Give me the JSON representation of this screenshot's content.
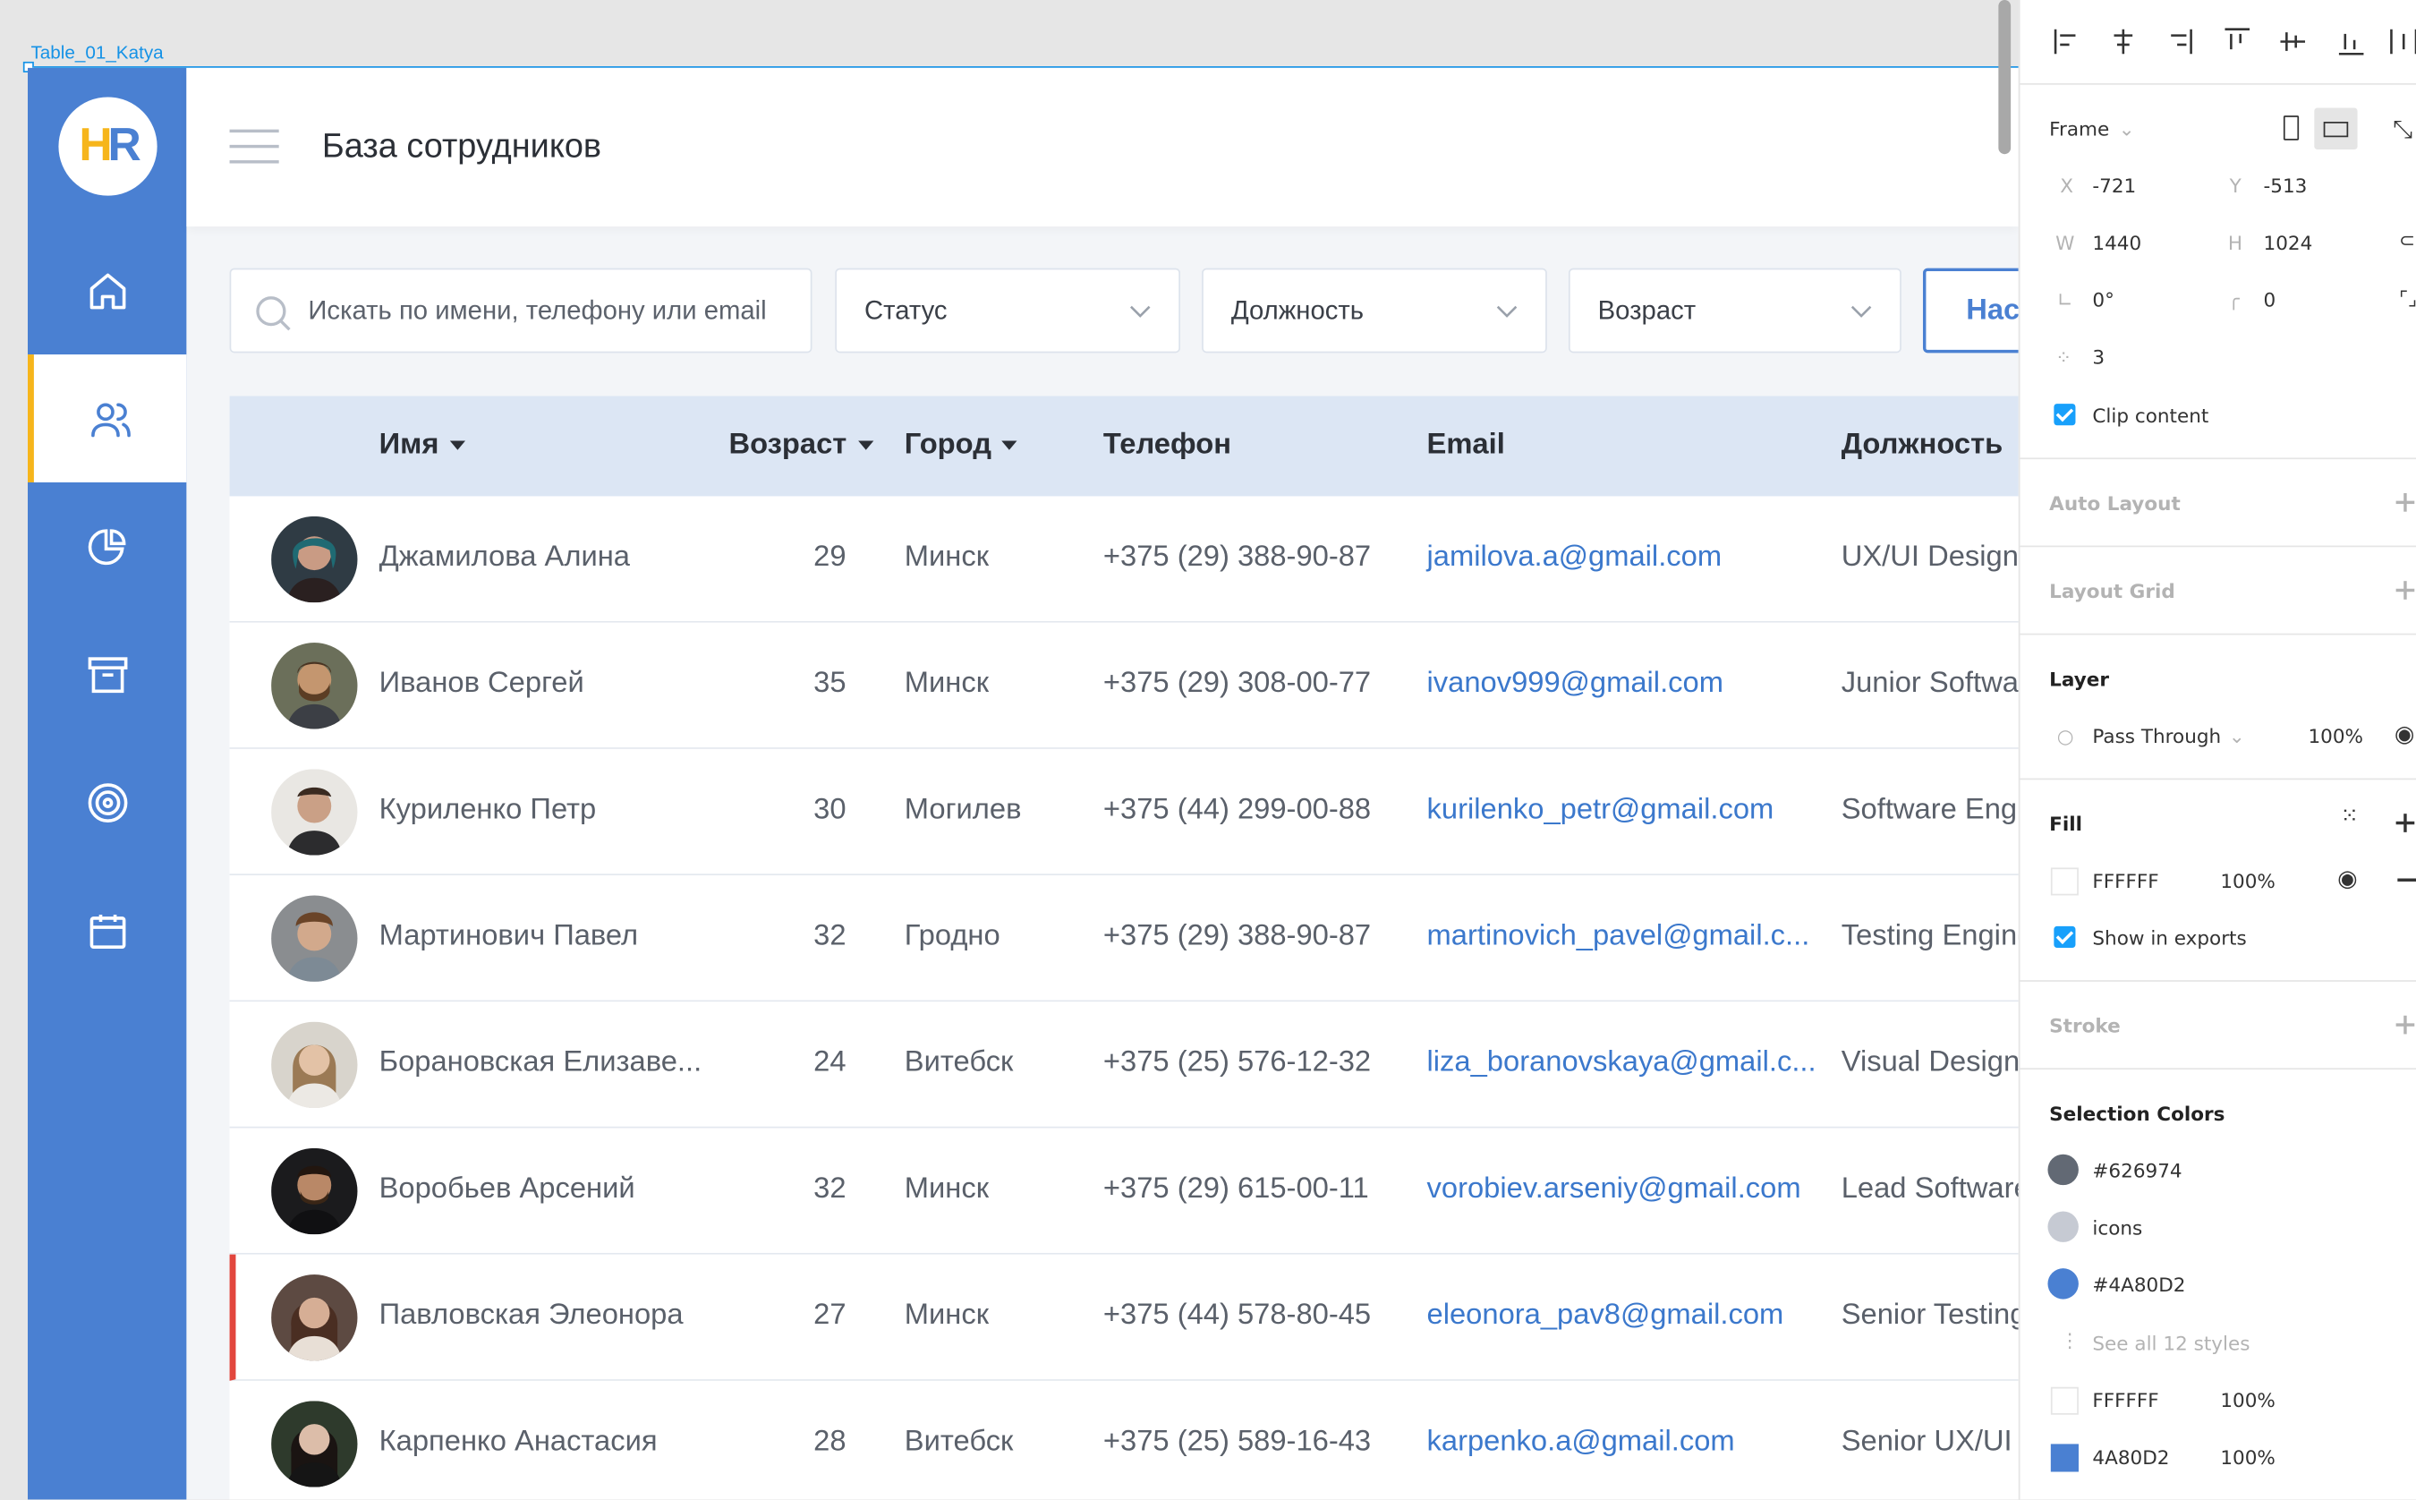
{
  "canvas": {
    "frame_label": "Table_01_Katya"
  },
  "app": {
    "logo": {
      "h": "H",
      "r": "R"
    },
    "title": "База сотрудников",
    "nav": [
      "home-icon",
      "users-icon",
      "chart-icon",
      "archive-icon",
      "target-icon",
      "calendar-icon"
    ],
    "filters": {
      "search_placeholder": "Искать по имени, телефону или email",
      "status": "Статус",
      "position": "Должность",
      "age": "Возраст"
    },
    "new_button": "Нас",
    "columns": {
      "name": "Имя",
      "age": "Возраст",
      "city": "Город",
      "phone": "Телефон",
      "email": "Email",
      "position": "Должность"
    },
    "rows": [
      {
        "name": "Джамилова Алина",
        "age": "29",
        "city": "Минск",
        "phone": "+375 (29) 388-90-87",
        "email": "jamilova.a@gmail.com",
        "position": "UX/UI Designe"
      },
      {
        "name": "Иванов Сергей",
        "age": "35",
        "city": "Минск",
        "phone": "+375 (29) 308-00-77",
        "email": "ivanov999@gmail.com",
        "position": "Junior Softwar"
      },
      {
        "name": "Куриленко Петр",
        "age": "30",
        "city": "Могилев",
        "phone": "+375 (44) 299-00-88",
        "email": "kurilenko_petr@gmail.com",
        "position": "Software Engi"
      },
      {
        "name": "Мартинович Павел",
        "age": "32",
        "city": "Гродно",
        "phone": "+375 (29) 388-90-87",
        "email": "martinovich_pavel@gmail.c...",
        "position": "Testing Engine"
      },
      {
        "name": "Борановская Елизаве...",
        "age": "24",
        "city": "Витебск",
        "phone": "+375 (25) 576-12-32",
        "email": "liza_boranovskaya@gmail.c...",
        "position": "Visual Designe"
      },
      {
        "name": "Воробьев Арсений",
        "age": "32",
        "city": "Минск",
        "phone": "+375 (29) 615-00-11",
        "email": "vorobiev.arseniy@gmail.com",
        "position": "Lead Software"
      },
      {
        "name": "Павловская Элеонора",
        "age": "27",
        "city": "Минск",
        "phone": "+375 (44) 578-80-45",
        "email": "eleonora_pav8@gmail.com",
        "position": "Senior Testing"
      },
      {
        "name": "Карпенко Анастасия",
        "age": "28",
        "city": "Витебск",
        "phone": "+375 (25) 589-16-43",
        "email": "karpenko.a@gmail.com",
        "position": "Senior UX/UI I"
      }
    ]
  },
  "panel": {
    "frame": {
      "label": "Frame"
    },
    "x_label": "X",
    "x": "-721",
    "y_label": "Y",
    "y": "-513",
    "w_label": "W",
    "w": "1440",
    "h_label": "H",
    "h": "1024",
    "rotation": "0°",
    "radius": "0",
    "points": "3",
    "clip_content": "Clip content",
    "auto_layout": "Auto Layout",
    "layout_grid": "Layout Grid",
    "layer": {
      "title": "Layer",
      "blend": "Pass Through",
      "opacity": "100%"
    },
    "fill": {
      "title": "Fill",
      "hex": "FFFFFF",
      "opacity": "100%"
    },
    "show_in_exports": "Show in exports",
    "stroke": "Stroke",
    "selection_colors": {
      "title": "Selection Colors",
      "items": [
        {
          "label": "#626974",
          "color": "#626974"
        },
        {
          "label": "icons",
          "color": "#c6cad3"
        },
        {
          "label": "#4A80D2",
          "color": "#4a80d2"
        }
      ],
      "see_all": "See all 12 styles",
      "swatches": [
        {
          "hex": "FFFFFF",
          "opacity": "100%",
          "color": "#ffffff"
        },
        {
          "hex": "4A80D2",
          "opacity": "100%",
          "color": "#4a80d2"
        }
      ]
    }
  }
}
